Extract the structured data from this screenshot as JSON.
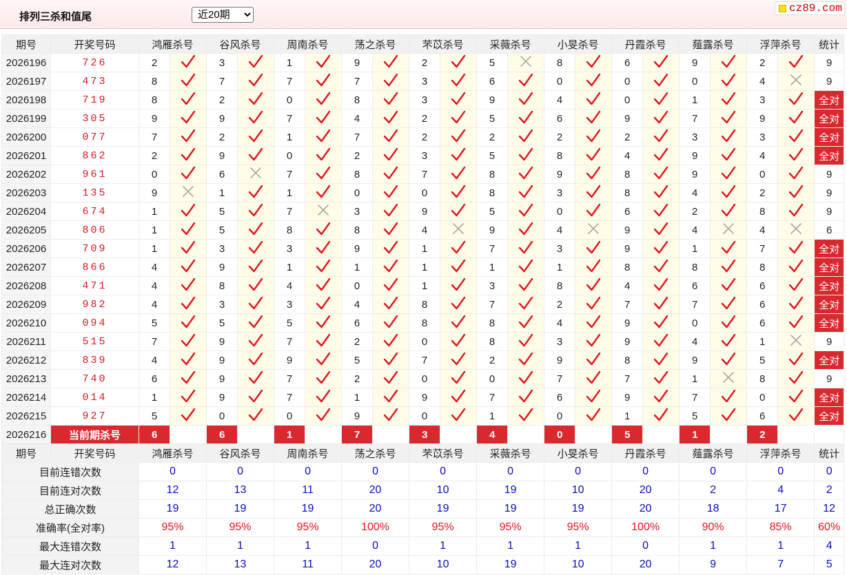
{
  "header": {
    "title": "排列三杀和值尾",
    "period_select": "近20期",
    "logo_text": "cz89.com"
  },
  "columns": [
    "期号",
    "开奖号码",
    "鸿雁杀号",
    "谷风杀号",
    "周南杀号",
    "荡之杀号",
    "芣苡杀号",
    "采薇杀号",
    "小旻杀号",
    "丹霞杀号",
    "薤露杀号",
    "浮萍杀号",
    "统计"
  ],
  "rows": [
    {
      "period": "2026196",
      "draw": "726",
      "kills": [
        [
          "2",
          1
        ],
        [
          "3",
          1
        ],
        [
          "1",
          1
        ],
        [
          "9",
          1
        ],
        [
          "2",
          1
        ],
        [
          "5",
          0
        ],
        [
          "8",
          1
        ],
        [
          "6",
          1
        ],
        [
          "9",
          1
        ],
        [
          "2",
          1
        ]
      ],
      "stat": "9"
    },
    {
      "period": "2026197",
      "draw": "473",
      "kills": [
        [
          "8",
          1
        ],
        [
          "7",
          1
        ],
        [
          "7",
          1
        ],
        [
          "7",
          1
        ],
        [
          "3",
          1
        ],
        [
          "6",
          1
        ],
        [
          "0",
          1
        ],
        [
          "0",
          1
        ],
        [
          "0",
          1
        ],
        [
          "4",
          0
        ]
      ],
      "stat": "9"
    },
    {
      "period": "2026198",
      "draw": "719",
      "kills": [
        [
          "8",
          1
        ],
        [
          "2",
          1
        ],
        [
          "0",
          1
        ],
        [
          "8",
          1
        ],
        [
          "3",
          1
        ],
        [
          "9",
          1
        ],
        [
          "4",
          1
        ],
        [
          "0",
          1
        ],
        [
          "1",
          1
        ],
        [
          "3",
          1
        ]
      ],
      "stat": "全对"
    },
    {
      "period": "2026199",
      "draw": "305",
      "kills": [
        [
          "9",
          1
        ],
        [
          "9",
          1
        ],
        [
          "7",
          1
        ],
        [
          "4",
          1
        ],
        [
          "2",
          1
        ],
        [
          "5",
          1
        ],
        [
          "6",
          1
        ],
        [
          "9",
          1
        ],
        [
          "7",
          1
        ],
        [
          "9",
          1
        ]
      ],
      "stat": "全对"
    },
    {
      "period": "2026200",
      "draw": "077",
      "kills": [
        [
          "7",
          1
        ],
        [
          "2",
          1
        ],
        [
          "1",
          1
        ],
        [
          "7",
          1
        ],
        [
          "2",
          1
        ],
        [
          "2",
          1
        ],
        [
          "2",
          1
        ],
        [
          "2",
          1
        ],
        [
          "3",
          1
        ],
        [
          "3",
          1
        ]
      ],
      "stat": "全对"
    },
    {
      "period": "2026201",
      "draw": "862",
      "kills": [
        [
          "2",
          1
        ],
        [
          "9",
          1
        ],
        [
          "0",
          1
        ],
        [
          "2",
          1
        ],
        [
          "3",
          1
        ],
        [
          "5",
          1
        ],
        [
          "8",
          1
        ],
        [
          "4",
          1
        ],
        [
          "9",
          1
        ],
        [
          "4",
          1
        ]
      ],
      "stat": "全对"
    },
    {
      "period": "2026202",
      "draw": "961",
      "kills": [
        [
          "0",
          1
        ],
        [
          "6",
          0
        ],
        [
          "7",
          1
        ],
        [
          "8",
          1
        ],
        [
          "7",
          1
        ],
        [
          "8",
          1
        ],
        [
          "9",
          1
        ],
        [
          "8",
          1
        ],
        [
          "9",
          1
        ],
        [
          "0",
          1
        ]
      ],
      "stat": "9"
    },
    {
      "period": "2026203",
      "draw": "135",
      "kills": [
        [
          "9",
          0
        ],
        [
          "1",
          1
        ],
        [
          "1",
          1
        ],
        [
          "0",
          1
        ],
        [
          "0",
          1
        ],
        [
          "8",
          1
        ],
        [
          "3",
          1
        ],
        [
          "8",
          1
        ],
        [
          "4",
          1
        ],
        [
          "2",
          1
        ]
      ],
      "stat": "9"
    },
    {
      "period": "2026204",
      "draw": "674",
      "kills": [
        [
          "1",
          1
        ],
        [
          "5",
          1
        ],
        [
          "7",
          0
        ],
        [
          "3",
          1
        ],
        [
          "9",
          1
        ],
        [
          "5",
          1
        ],
        [
          "0",
          1
        ],
        [
          "6",
          1
        ],
        [
          "2",
          1
        ],
        [
          "8",
          1
        ]
      ],
      "stat": "9"
    },
    {
      "period": "2026205",
      "draw": "806",
      "kills": [
        [
          "1",
          1
        ],
        [
          "5",
          1
        ],
        [
          "8",
          1
        ],
        [
          "8",
          1
        ],
        [
          "4",
          0
        ],
        [
          "9",
          1
        ],
        [
          "4",
          0
        ],
        [
          "9",
          1
        ],
        [
          "4",
          0
        ],
        [
          "4",
          0
        ]
      ],
      "stat": "6"
    },
    {
      "period": "2026206",
      "draw": "709",
      "kills": [
        [
          "1",
          1
        ],
        [
          "3",
          1
        ],
        [
          "3",
          1
        ],
        [
          "9",
          1
        ],
        [
          "1",
          1
        ],
        [
          "7",
          1
        ],
        [
          "3",
          1
        ],
        [
          "9",
          1
        ],
        [
          "1",
          1
        ],
        [
          "7",
          1
        ]
      ],
      "stat": "全对"
    },
    {
      "period": "2026207",
      "draw": "866",
      "kills": [
        [
          "4",
          1
        ],
        [
          "9",
          1
        ],
        [
          "1",
          1
        ],
        [
          "1",
          1
        ],
        [
          "1",
          1
        ],
        [
          "1",
          1
        ],
        [
          "1",
          1
        ],
        [
          "8",
          1
        ],
        [
          "8",
          1
        ],
        [
          "8",
          1
        ]
      ],
      "stat": "全对"
    },
    {
      "period": "2026208",
      "draw": "471",
      "kills": [
        [
          "4",
          1
        ],
        [
          "8",
          1
        ],
        [
          "4",
          1
        ],
        [
          "0",
          1
        ],
        [
          "1",
          1
        ],
        [
          "3",
          1
        ],
        [
          "8",
          1
        ],
        [
          "4",
          1
        ],
        [
          "6",
          1
        ],
        [
          "6",
          1
        ]
      ],
      "stat": "全对"
    },
    {
      "period": "2026209",
      "draw": "982",
      "kills": [
        [
          "4",
          1
        ],
        [
          "3",
          1
        ],
        [
          "3",
          1
        ],
        [
          "4",
          1
        ],
        [
          "8",
          1
        ],
        [
          "7",
          1
        ],
        [
          "2",
          1
        ],
        [
          "7",
          1
        ],
        [
          "7",
          1
        ],
        [
          "6",
          1
        ]
      ],
      "stat": "全对"
    },
    {
      "period": "2026210",
      "draw": "094",
      "kills": [
        [
          "5",
          1
        ],
        [
          "5",
          1
        ],
        [
          "5",
          1
        ],
        [
          "6",
          1
        ],
        [
          "8",
          1
        ],
        [
          "8",
          1
        ],
        [
          "4",
          1
        ],
        [
          "9",
          1
        ],
        [
          "0",
          1
        ],
        [
          "6",
          1
        ]
      ],
      "stat": "全对"
    },
    {
      "period": "2026211",
      "draw": "515",
      "kills": [
        [
          "7",
          1
        ],
        [
          "9",
          1
        ],
        [
          "7",
          1
        ],
        [
          "2",
          1
        ],
        [
          "0",
          1
        ],
        [
          "8",
          1
        ],
        [
          "3",
          1
        ],
        [
          "9",
          1
        ],
        [
          "4",
          1
        ],
        [
          "1",
          0
        ]
      ],
      "stat": "9"
    },
    {
      "period": "2026212",
      "draw": "839",
      "kills": [
        [
          "4",
          1
        ],
        [
          "9",
          1
        ],
        [
          "9",
          1
        ],
        [
          "5",
          1
        ],
        [
          "7",
          1
        ],
        [
          "2",
          1
        ],
        [
          "9",
          1
        ],
        [
          "8",
          1
        ],
        [
          "9",
          1
        ],
        [
          "5",
          1
        ]
      ],
      "stat": "全对"
    },
    {
      "period": "2026213",
      "draw": "740",
      "kills": [
        [
          "6",
          1
        ],
        [
          "9",
          1
        ],
        [
          "7",
          1
        ],
        [
          "2",
          1
        ],
        [
          "0",
          1
        ],
        [
          "0",
          1
        ],
        [
          "7",
          1
        ],
        [
          "7",
          1
        ],
        [
          "1",
          0
        ],
        [
          "8",
          1
        ]
      ],
      "stat": "9"
    },
    {
      "period": "2026214",
      "draw": "014",
      "kills": [
        [
          "1",
          1
        ],
        [
          "9",
          1
        ],
        [
          "7",
          1
        ],
        [
          "1",
          1
        ],
        [
          "9",
          1
        ],
        [
          "7",
          1
        ],
        [
          "6",
          1
        ],
        [
          "9",
          1
        ],
        [
          "7",
          1
        ],
        [
          "0",
          1
        ]
      ],
      "stat": "全对"
    },
    {
      "period": "2026215",
      "draw": "927",
      "kills": [
        [
          "5",
          1
        ],
        [
          "0",
          1
        ],
        [
          "0",
          1
        ],
        [
          "9",
          1
        ],
        [
          "0",
          1
        ],
        [
          "1",
          1
        ],
        [
          "0",
          1
        ],
        [
          "1",
          1
        ],
        [
          "5",
          1
        ],
        [
          "6",
          1
        ]
      ],
      "stat": "全对"
    }
  ],
  "current": {
    "period": "2026216",
    "label": "当前期杀号",
    "kills": [
      "6",
      "6",
      "1",
      "7",
      "3",
      "4",
      "0",
      "5",
      "1",
      "2"
    ]
  },
  "summary": [
    {
      "label": "目前连错次数",
      "values": [
        "0",
        "0",
        "0",
        "0",
        "0",
        "0",
        "0",
        "0",
        "0",
        "0"
      ],
      "stat": "0",
      "style": "val"
    },
    {
      "label": "目前连对次数",
      "values": [
        "12",
        "13",
        "11",
        "20",
        "10",
        "19",
        "10",
        "20",
        "2",
        "4"
      ],
      "stat": "2",
      "style": "val"
    },
    {
      "label": "总正确次数",
      "values": [
        "19",
        "19",
        "19",
        "20",
        "19",
        "19",
        "19",
        "20",
        "18",
        "17"
      ],
      "stat": "12",
      "style": "val"
    },
    {
      "label": "准确率(全对率)",
      "values": [
        "95%",
        "95%",
        "95%",
        "100%",
        "95%",
        "95%",
        "95%",
        "100%",
        "90%",
        "85%"
      ],
      "stat": "60%",
      "style": "rate"
    },
    {
      "label": "最大连错次数",
      "values": [
        "1",
        "1",
        "1",
        "0",
        "1",
        "1",
        "1",
        "0",
        "1",
        "1"
      ],
      "stat": "4",
      "style": "val"
    },
    {
      "label": "最大连对次数",
      "values": [
        "12",
        "13",
        "11",
        "20",
        "10",
        "19",
        "10",
        "20",
        "9",
        "7"
      ],
      "stat": "5",
      "style": "val"
    }
  ],
  "colors": {
    "accent_red": "#d9282e",
    "number_blue": "#0a0ac4",
    "mark_bg": "#fffde8"
  }
}
